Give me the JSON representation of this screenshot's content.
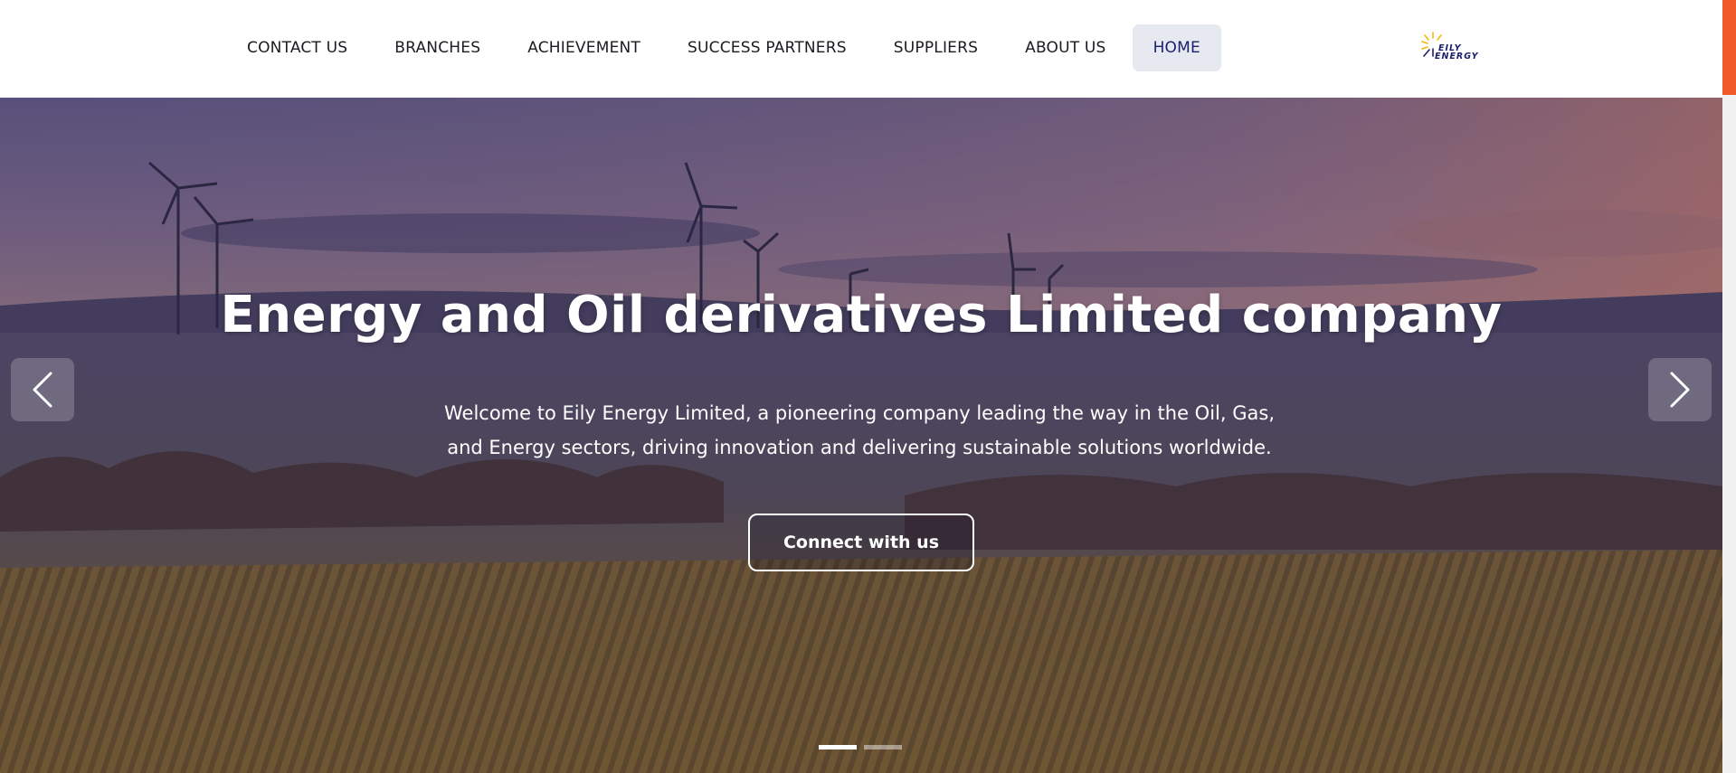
{
  "nav": {
    "items": [
      {
        "label": "CONTACT US"
      },
      {
        "label": "BRANCHES"
      },
      {
        "label": "ACHIEVEMENT"
      },
      {
        "label": "SUCCESS PARTNERS"
      },
      {
        "label": "SUPPLIERS"
      },
      {
        "label": "ABOUT US"
      },
      {
        "label": "HOME",
        "active": true
      }
    ]
  },
  "logo": {
    "line1": "EILY",
    "line2": "ENERGY",
    "icon": "sun-burst-icon"
  },
  "hero": {
    "title": "Energy and Oil derivatives Limited company",
    "description_line1": "Welcome to Eily Energy Limited, a pioneering company leading the way in the Oil, Gas,",
    "description_line2": "and Energy sectors, driving innovation and delivering sustainable solutions worldwide.",
    "cta_label": "Connect with us",
    "prev_icon": "chevron-left-icon",
    "next_icon": "chevron-right-icon",
    "slide_count": 2,
    "active_slide": 1
  },
  "colors": {
    "accent": "#f05a2b",
    "nav_active_bg": "#e7e9f1",
    "brand_navy": "#1a1f6b",
    "logo_yellow": "#f6b40e"
  }
}
